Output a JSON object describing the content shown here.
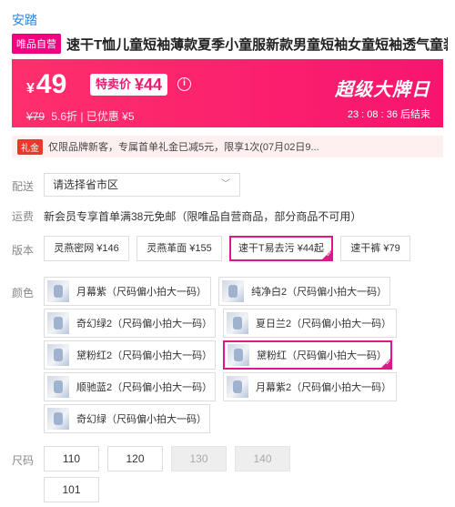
{
  "brand": "安踏",
  "product": {
    "tag": "唯品自营",
    "title": "速干T恤儿童短袖薄款夏季小童服新款男童短袖女童短袖透气童装"
  },
  "price": {
    "currency": "¥",
    "current": "49",
    "special_label": "特卖价",
    "special_price": "¥44",
    "info_icon": "i",
    "original": "¥79",
    "discount": "5.6折 | 已优惠 ¥5",
    "sale_label": "超级大牌日",
    "countdown": "23 : 08 : 36  后结束"
  },
  "gift": {
    "tag": "礼金",
    "text": "仅限品牌新客，专属首单礼金已减5元，限享1次(07月02日9..."
  },
  "delivery": {
    "label": "配送",
    "placeholder": "请选择省市区",
    "chevron": "﹀"
  },
  "shipping": {
    "label": "运费",
    "text": "新会员专享首单满38元免邮（限唯品自营商品，部分商品不可用）"
  },
  "version": {
    "label": "版本",
    "options": [
      "灵燕密网 ¥146",
      "灵燕革面 ¥155",
      "速干T易去污 ¥44起",
      "速干裤 ¥79"
    ]
  },
  "colors": {
    "label": "颜色",
    "options": [
      "月幕紫（尺码偏小拍大一码）",
      "纯净白2（尺码偏小拍大一码）",
      "奇幻绿2（尺码偏小拍大一码）",
      "夏日兰2（尺码偏小拍大一码）",
      "黛粉红2（尺码偏小拍大一码）",
      "黛粉红（尺码偏小拍大一码）",
      "顺驰蓝2（尺码偏小拍大一码）",
      "月幕紫2（尺码偏小拍大一码）",
      "奇幻绿（尺码偏小拍大一码）"
    ]
  },
  "sizes": {
    "label": "尺码",
    "options": [
      "110",
      "120",
      "130",
      "140",
      "101"
    ]
  },
  "colors_theme": {
    "accent": "#f10180",
    "selected_border": "#e0168a",
    "brand_link": "#2a86d8"
  }
}
